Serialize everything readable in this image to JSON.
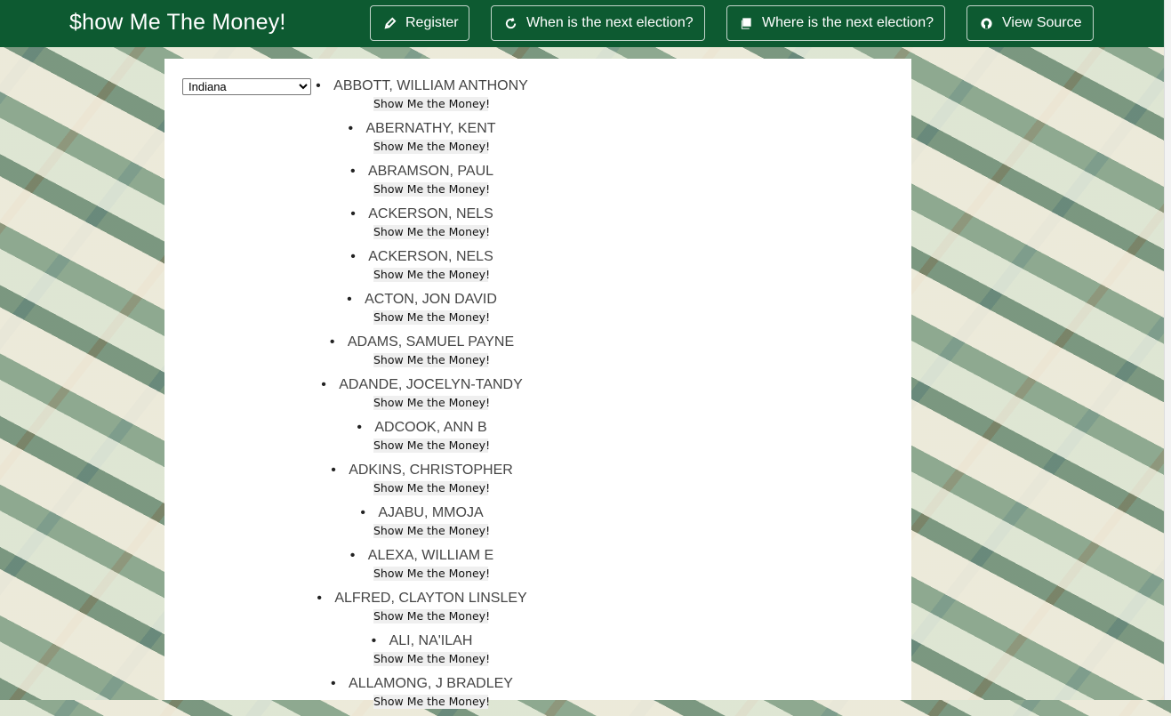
{
  "navbar": {
    "brand": "$how Me The Money!",
    "buttons": [
      {
        "label": "Register",
        "icon": "pencil-icon"
      },
      {
        "label": "When is the next election?",
        "icon": "refresh-icon"
      },
      {
        "label": "Where is the next election?",
        "icon": "book-icon"
      },
      {
        "label": "View Source",
        "icon": "github-icon"
      }
    ]
  },
  "state_select": {
    "selected": "Indiana"
  },
  "button_label": "Show Me the Money!",
  "candidates": [
    "ABBOTT, WILLIAM ANTHONY",
    "ABERNATHY, KENT",
    "ABRAMSON, PAUL",
    "ACKERSON, NELS",
    "ACKERSON, NELS",
    "ACTON, JON DAVID",
    "ADAMS, SAMUEL PAYNE",
    "ADANDE, JOCELYN-TANDY",
    "ADCOOK, ANN B",
    "ADKINS, CHRISTOPHER",
    "AJABU, MMOJA",
    "ALEXA, WILLIAM E",
    "ALFRED, CLAYTON LINSLEY",
    "ALI, NA'ILAH",
    "ALLAMONG, J BRADLEY"
  ],
  "colors": {
    "navbar": "#0d5a31",
    "panel": "#ffffff"
  }
}
